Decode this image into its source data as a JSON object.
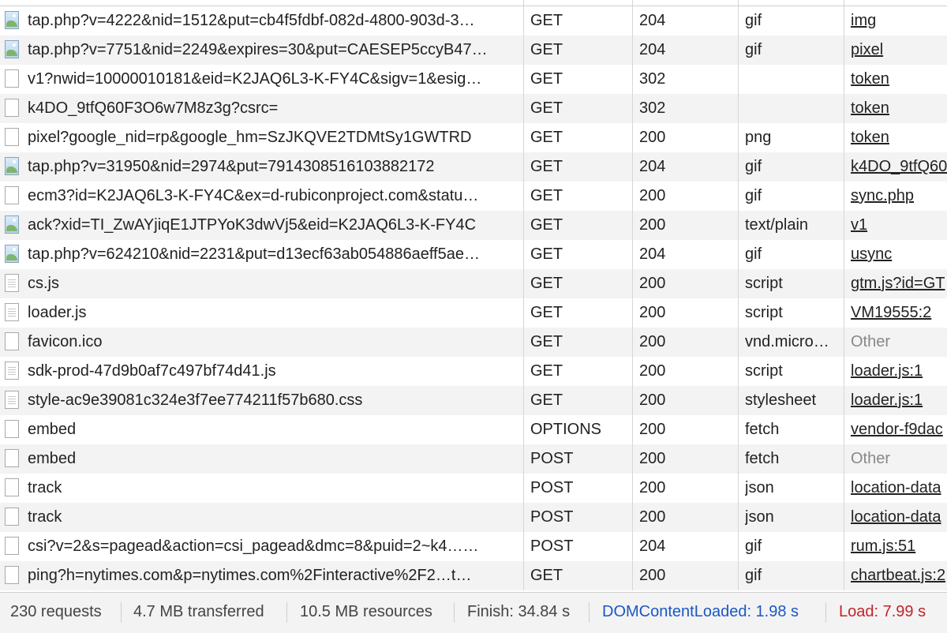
{
  "requests": [
    {
      "name": "tap.php?v=4222&nid=1512&put=cb4f5fdbf-082d-4800-903d-3…",
      "icon": "image-icon",
      "method": "GET",
      "status": "204",
      "type": "gif",
      "initiator": "img",
      "initiator_style": "link"
    },
    {
      "name": "tap.php?v=7751&nid=2249&expires=30&put=CAESEP5ccyB47…",
      "icon": "image-icon",
      "method": "GET",
      "status": "204",
      "type": "gif",
      "initiator": "pixel",
      "initiator_style": "link"
    },
    {
      "name": "v1?nwid=10000010181&eid=K2JAQ6L3-K-FY4C&sigv=1&esig…",
      "icon": "blank-file-icon",
      "method": "GET",
      "status": "302",
      "type": "",
      "initiator": "token",
      "initiator_style": "link"
    },
    {
      "name": "k4DO_9tfQ60F3O6w7M8z3g?csrc=",
      "icon": "blank-file-icon",
      "method": "GET",
      "status": "302",
      "type": "",
      "initiator": "token",
      "initiator_style": "link"
    },
    {
      "name": "pixel?google_nid=rp&google_hm=SzJKQVE2TDMtSy1GWTRD",
      "icon": "blank-file-icon",
      "method": "GET",
      "status": "200",
      "type": "png",
      "initiator": "token",
      "initiator_style": "link"
    },
    {
      "name": "tap.php?v=31950&nid=2974&put=7914308516103882172",
      "icon": "image-icon",
      "method": "GET",
      "status": "204",
      "type": "gif",
      "initiator": "k4DO_9tfQ60",
      "initiator_style": "link"
    },
    {
      "name": "ecm3?id=K2JAQ6L3-K-FY4C&ex=d-rubiconproject.com&statu…",
      "icon": "blank-file-icon",
      "method": "GET",
      "status": "200",
      "type": "gif",
      "initiator": "sync.php",
      "initiator_style": "link"
    },
    {
      "name": "ack?xid=TI_ZwAYjiqE1JTPYoK3dwVj5&eid=K2JAQ6L3-K-FY4C",
      "icon": "image-icon",
      "method": "GET",
      "status": "200",
      "type": "text/plain",
      "initiator": "v1",
      "initiator_style": "link"
    },
    {
      "name": "tap.php?v=624210&nid=2231&put=d13ecf63ab054886aeff5ae…",
      "icon": "image-icon",
      "method": "GET",
      "status": "204",
      "type": "gif",
      "initiator": "usync",
      "initiator_style": "link"
    },
    {
      "name": "cs.js",
      "icon": "script-file-icon",
      "method": "GET",
      "status": "200",
      "type": "script",
      "initiator": "gtm.js?id=GT",
      "initiator_style": "link"
    },
    {
      "name": "loader.js",
      "icon": "script-file-icon",
      "method": "GET",
      "status": "200",
      "type": "script",
      "initiator": "VM19555:2",
      "initiator_style": "link"
    },
    {
      "name": "favicon.ico",
      "icon": "blank-file-icon",
      "method": "GET",
      "status": "200",
      "type": "vnd.micro…",
      "initiator": "Other",
      "initiator_style": "muted"
    },
    {
      "name": "sdk-prod-47d9b0af7c497bf74d41.js",
      "icon": "script-file-icon",
      "method": "GET",
      "status": "200",
      "type": "script",
      "initiator": "loader.js:1",
      "initiator_style": "link"
    },
    {
      "name": "style-ac9e39081c324e3f7ee774211f57b680.css",
      "icon": "stylesheet-file-icon",
      "method": "GET",
      "status": "200",
      "type": "stylesheet",
      "initiator": "loader.js:1",
      "initiator_style": "link"
    },
    {
      "name": "embed",
      "icon": "blank-file-icon",
      "method": "OPTIONS",
      "status": "200",
      "type": "fetch",
      "initiator": "vendor-f9dac",
      "initiator_style": "link"
    },
    {
      "name": "embed",
      "icon": "blank-file-icon",
      "method": "POST",
      "status": "200",
      "type": "fetch",
      "initiator": "Other",
      "initiator_style": "muted"
    },
    {
      "name": "track",
      "icon": "blank-file-icon",
      "method": "POST",
      "status": "200",
      "type": "json",
      "initiator": "location-data",
      "initiator_style": "link"
    },
    {
      "name": "track",
      "icon": "blank-file-icon",
      "method": "POST",
      "status": "200",
      "type": "json",
      "initiator": "location-data",
      "initiator_style": "link"
    },
    {
      "name": "csi?v=2&s=pagead&action=csi_pagead&dmc=8&puid=2~k4……",
      "icon": "blank-file-icon",
      "method": "POST",
      "status": "204",
      "type": "gif",
      "initiator": "rum.js:51",
      "initiator_style": "link"
    },
    {
      "name": "ping?h=nytimes.com&p=nytimes.com%2Finteractive%2F2…t…",
      "icon": "blank-file-icon",
      "method": "GET",
      "status": "200",
      "type": "gif",
      "initiator": "chartbeat.js:2",
      "initiator_style": "link"
    }
  ],
  "summary": {
    "requests": "230 requests",
    "transferred": "4.7 MB transferred",
    "resources": "10.5 MB resources",
    "finish": "Finish: 34.84 s",
    "dom_content_loaded": "DOMContentLoaded: 1.98 s",
    "load": "Load: 7.99 s"
  },
  "colors": {
    "dom_content_loaded": "#1a57c5",
    "load": "#c0242b",
    "row_stripe": "#f3f3f3"
  }
}
